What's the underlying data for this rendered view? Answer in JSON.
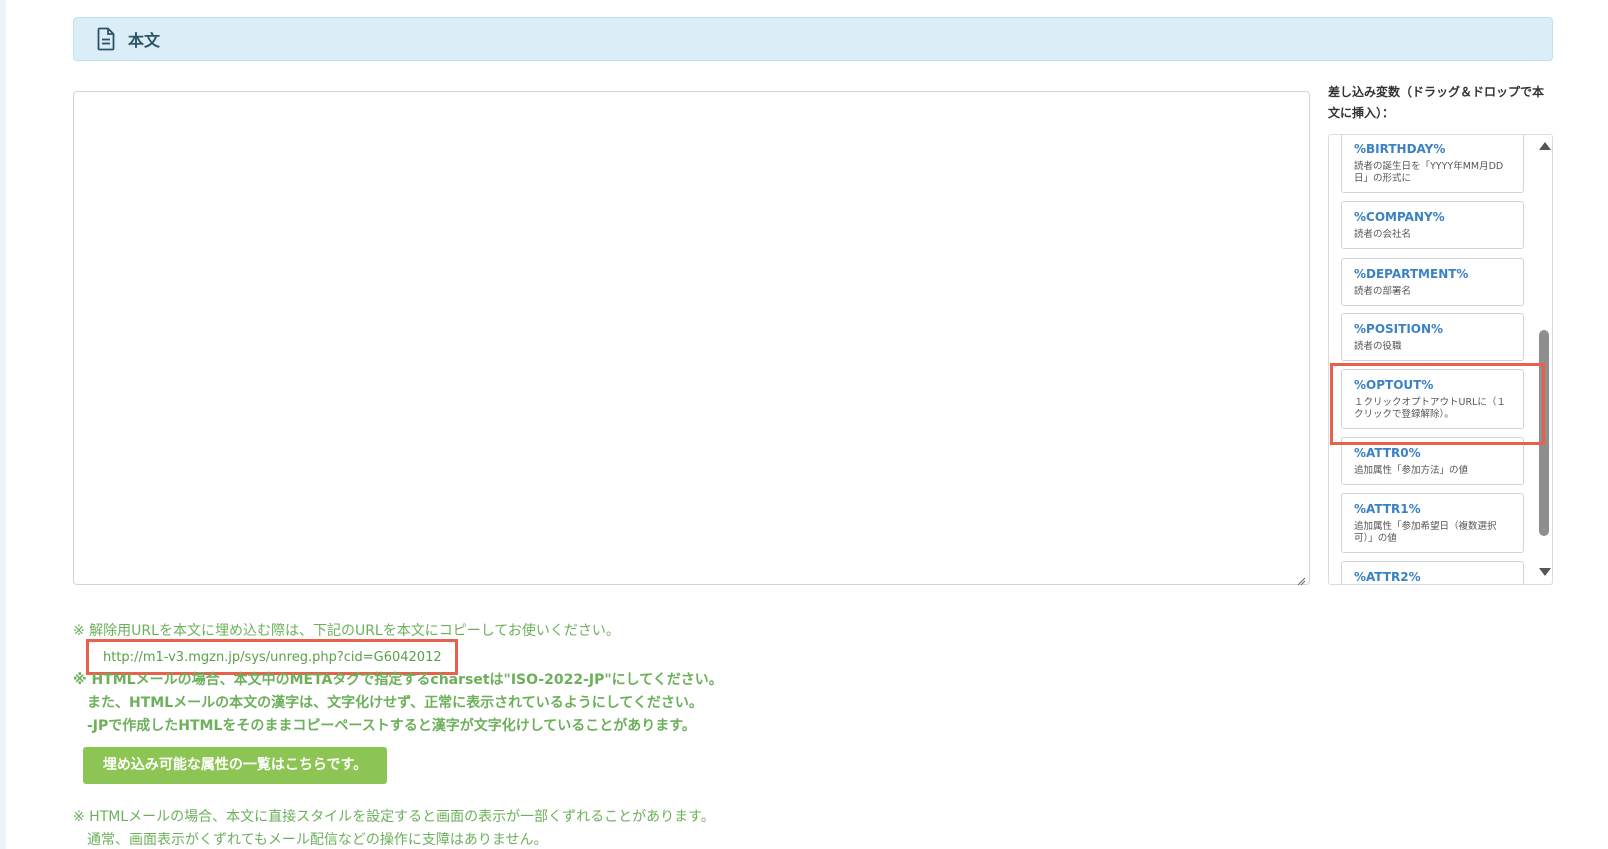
{
  "section": {
    "title": "本文",
    "icon": "document-icon"
  },
  "editor": {
    "value": ""
  },
  "variables": {
    "label": "差し込み変数（ドラッグ＆ドロップで本文に挿入）：",
    "items": [
      {
        "name": "%BIRTHDAY%",
        "desc": "読者の誕生日を「YYYY年MM月DD日」の形式に"
      },
      {
        "name": "%COMPANY%",
        "desc": "読者の会社名"
      },
      {
        "name": "%DEPARTMENT%",
        "desc": "読者の部署名"
      },
      {
        "name": "%POSITION%",
        "desc": "読者の役職"
      },
      {
        "name": "%OPTOUT%",
        "desc": "１クリックオプトアウトURLに（１クリックで登録解除）。"
      },
      {
        "name": "%ATTR0%",
        "desc": "追加属性「参加方法」の値"
      },
      {
        "name": "%ATTR1%",
        "desc": "追加属性「参加希望日（複数選択可）」の値"
      },
      {
        "name": "%ATTR2%",
        "desc": ""
      }
    ]
  },
  "notes": {
    "unsubscribe_note": "※ 解除用URLを本文に埋め込む際は、下記のURLを本文にコピーしてお使いください。",
    "unsubscribe_url": "http://m1-v3.mgzn.jp/sys/unreg.php?cid=G6042012",
    "charset_note_1": "※ HTMLメールの場合、本文中のMETAタグで指定するcharsetは\"ISO-2022-JP\"にしてください。",
    "charset_note_2": "また、HTMLメールの本文の漢字は、文字化けせず、正常に表示されているようにしてください。",
    "charset_note_3": "-JPで作成したHTMLをそのままコピーペーストすると漢字が文字化けしていることがあります。",
    "attributes_button": "埋め込み可能な属性の一覧はこちらです。",
    "style_note_1": "※ HTMLメールの場合、本文に直接スタイルを設定すると画面の表示が一部くずれることがあります。",
    "style_note_2": "通常、画面表示がくずれてもメール配信などの操作に支障はありません。"
  },
  "colors": {
    "accent_green": "#8dc554",
    "note_green": "#6cb05a",
    "highlight_red": "#e8614d",
    "variable_blue": "#3a82c4"
  }
}
